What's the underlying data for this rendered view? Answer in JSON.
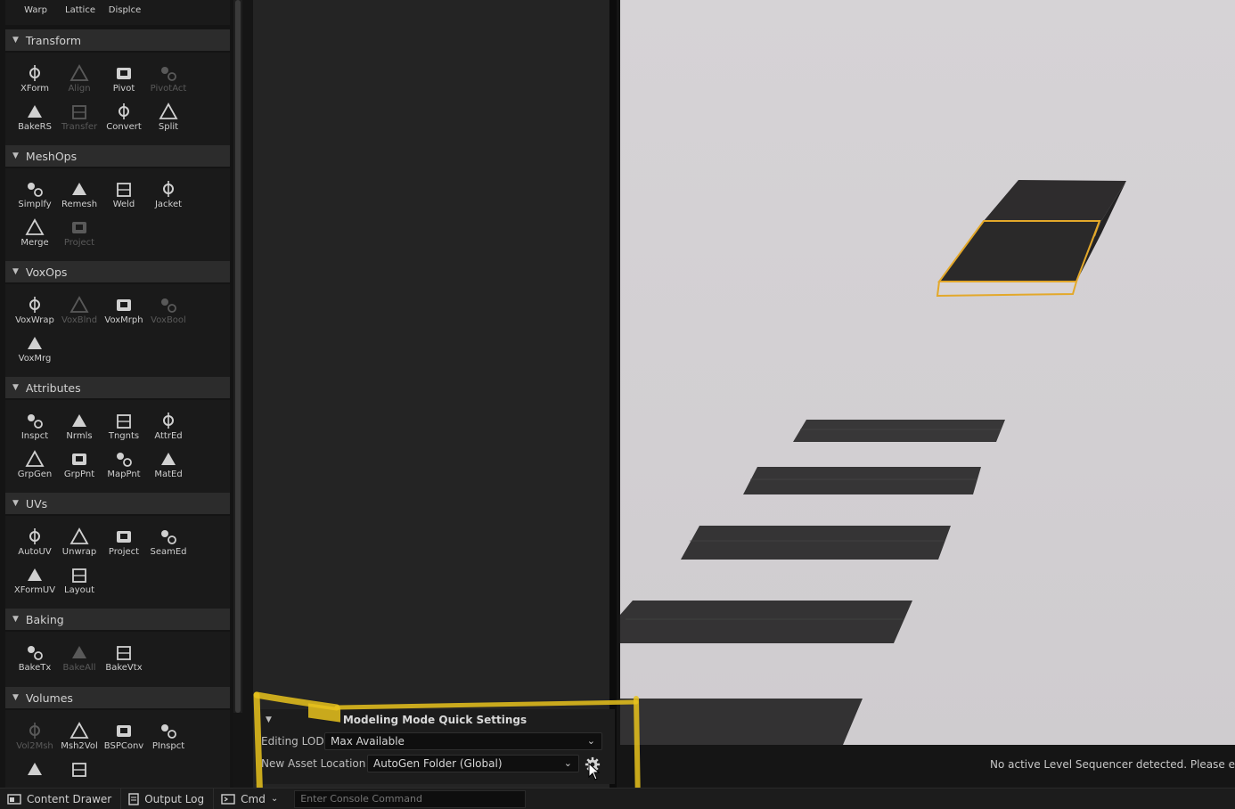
{
  "palette": {
    "top_row": [
      "Warp",
      "Lattice",
      "Displce"
    ],
    "sections": [
      {
        "title": "Transform",
        "tools": [
          {
            "label": "XForm",
            "icon": "xform-icon",
            "enabled": true
          },
          {
            "label": "Align",
            "icon": "align-icon",
            "enabled": false
          },
          {
            "label": "Pivot",
            "icon": "pivot-icon",
            "enabled": true
          },
          {
            "label": "PivotAct",
            "icon": "pivot-actor-icon",
            "enabled": false
          },
          {
            "label": "BakeRS",
            "icon": "bake-rs-icon",
            "enabled": true
          },
          {
            "label": "Transfer",
            "icon": "transfer-icon",
            "enabled": false
          },
          {
            "label": "Convert",
            "icon": "convert-icon",
            "enabled": true
          },
          {
            "label": "Split",
            "icon": "split-icon",
            "enabled": true
          }
        ]
      },
      {
        "title": "MeshOps",
        "tools": [
          {
            "label": "Simplfy",
            "icon": "simplify-icon",
            "enabled": true
          },
          {
            "label": "Remesh",
            "icon": "remesh-icon",
            "enabled": true
          },
          {
            "label": "Weld",
            "icon": "weld-icon",
            "enabled": true
          },
          {
            "label": "Jacket",
            "icon": "jacket-icon",
            "enabled": true
          },
          {
            "label": "Merge",
            "icon": "merge-icon",
            "enabled": true
          },
          {
            "label": "Project",
            "icon": "project-icon",
            "enabled": false
          }
        ]
      },
      {
        "title": "VoxOps",
        "tools": [
          {
            "label": "VoxWrap",
            "icon": "vox-wrap-icon",
            "enabled": true
          },
          {
            "label": "VoxBlnd",
            "icon": "vox-blend-icon",
            "enabled": false
          },
          {
            "label": "VoxMrph",
            "icon": "vox-morph-icon",
            "enabled": true
          },
          {
            "label": "VoxBool",
            "icon": "vox-bool-icon",
            "enabled": false
          },
          {
            "label": "VoxMrg",
            "icon": "vox-merge-icon",
            "enabled": true
          }
        ]
      },
      {
        "title": "Attributes",
        "tools": [
          {
            "label": "Inspct",
            "icon": "inspect-icon",
            "enabled": true
          },
          {
            "label": "Nrmls",
            "icon": "normals-icon",
            "enabled": true
          },
          {
            "label": "Tngnts",
            "icon": "tangents-icon",
            "enabled": true
          },
          {
            "label": "AttrEd",
            "icon": "attribute-editor-icon",
            "enabled": true
          },
          {
            "label": "GrpGen",
            "icon": "group-gen-icon",
            "enabled": true
          },
          {
            "label": "GrpPnt",
            "icon": "group-paint-icon",
            "enabled": true
          },
          {
            "label": "MapPnt",
            "icon": "map-paint-icon",
            "enabled": true
          },
          {
            "label": "MatEd",
            "icon": "material-editor-icon",
            "enabled": true
          }
        ]
      },
      {
        "title": "UVs",
        "tools": [
          {
            "label": "AutoUV",
            "icon": "auto-uv-icon",
            "enabled": true
          },
          {
            "label": "Unwrap",
            "icon": "unwrap-icon",
            "enabled": true
          },
          {
            "label": "Project",
            "icon": "uv-project-icon",
            "enabled": true
          },
          {
            "label": "SeamEd",
            "icon": "seam-editor-icon",
            "enabled": true
          },
          {
            "label": "XFormUV",
            "icon": "xform-uv-icon",
            "enabled": true
          },
          {
            "label": "Layout",
            "icon": "layout-icon",
            "enabled": true
          }
        ]
      },
      {
        "title": "Baking",
        "tools": [
          {
            "label": "BakeTx",
            "icon": "bake-texture-icon",
            "enabled": true
          },
          {
            "label": "BakeAll",
            "icon": "bake-all-icon",
            "enabled": false
          },
          {
            "label": "BakeVtx",
            "icon": "bake-vertex-icon",
            "enabled": true
          }
        ]
      },
      {
        "title": "Volumes",
        "tools": [
          {
            "label": "Vol2Msh",
            "icon": "vol-to-mesh-icon",
            "enabled": false
          },
          {
            "label": "Msh2Vol",
            "icon": "mesh-to-vol-icon",
            "enabled": true
          },
          {
            "label": "BSPConv",
            "icon": "bsp-convert-icon",
            "enabled": true
          },
          {
            "label": "PInspct",
            "icon": "physics-inspect-icon",
            "enabled": true
          },
          {
            "label": "",
            "icon": "mesh-to-coll-icon",
            "enabled": true
          },
          {
            "label": "",
            "icon": "coll-to-mesh-icon",
            "enabled": true
          }
        ]
      }
    ]
  },
  "quick_settings": {
    "title": "Modeling Mode Quick Settings",
    "editing_lod_label": "Editing LOD",
    "editing_lod_value": "Max Available",
    "asset_location_label": "New Asset Location",
    "asset_location_value": "AutoGen Folder (Global)"
  },
  "viewport": {
    "status_text": "No active Level Sequencer detected. Please e"
  },
  "bottom_bar": {
    "content_drawer": "Content Drawer",
    "output_log": "Output Log",
    "cmd": "Cmd",
    "console_placeholder": "Enter Console Command"
  },
  "colors": {
    "highlight": "#e8c21c",
    "selection_outline": "#e3a82a",
    "panel_bg": "#242424"
  }
}
